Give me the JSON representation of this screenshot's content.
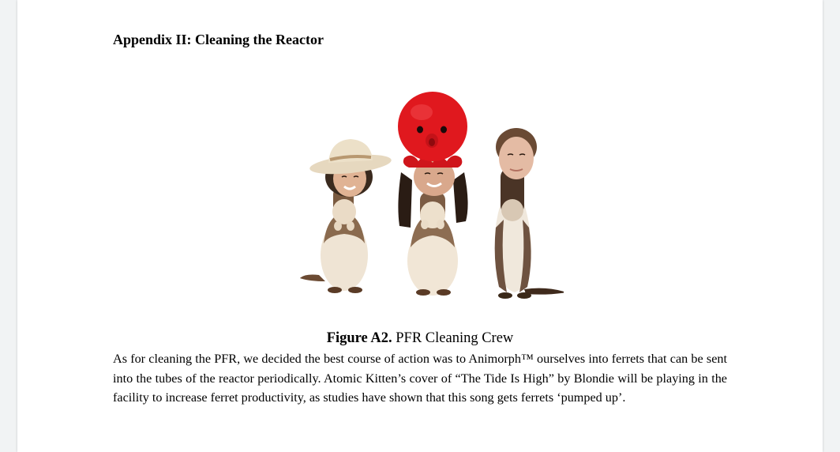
{
  "document": {
    "heading": "Appendix II: Cleaning the Reactor",
    "figure": {
      "label": "Figure A2.",
      "caption": "PFR Cleaning Crew",
      "image_alt": "Three ferrets wearing human faces: one in a cowboy hat, one with a red octopus plush on its head, and one plain"
    },
    "paragraph": "As for cleaning the PFR, we decided the best course of action was to Animorph™ ourselves into ferrets that can be sent into the tubes of the reactor periodically. Atomic Kitten’s cover of “The Tide Is High” by Blondie will be playing in the facility to increase ferret productivity, as studies have shown that this song gets ferrets ‘pumped up’."
  },
  "colors": {
    "page_background": "#ffffff",
    "canvas_background": "#f1f3f4",
    "text": "#000000",
    "octopus_red": "#e0181e"
  }
}
